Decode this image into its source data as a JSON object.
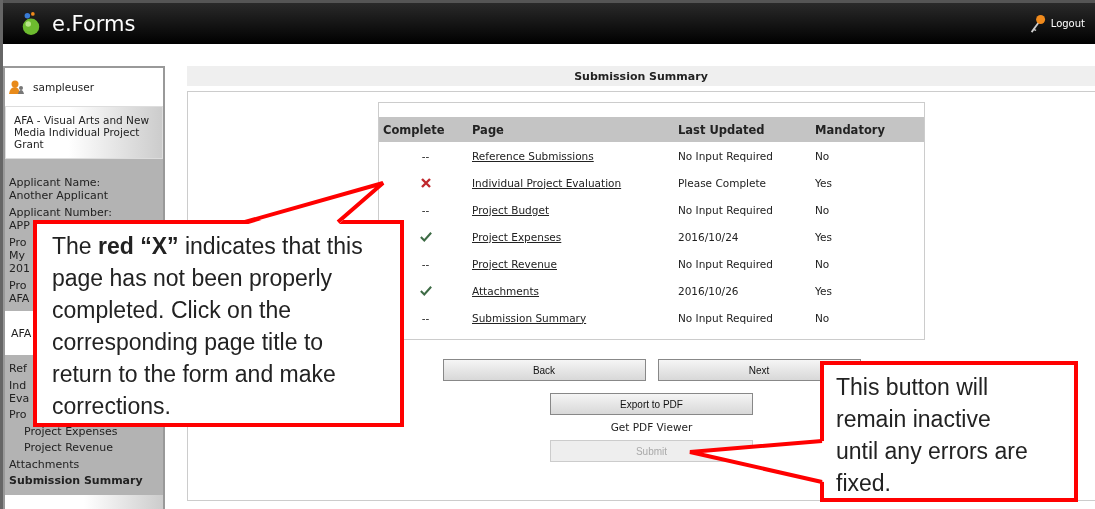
{
  "header": {
    "title": "e.Forms",
    "logout": "Logout"
  },
  "sidebar": {
    "user": "sampleuser",
    "form_title": "AFA - Visual Arts and New Media Individual Project Grant",
    "info": [
      {
        "label": "Applicant Name:",
        "value": [
          "Another Applicant"
        ]
      },
      {
        "label": "Applicant Number:",
        "value": [
          "APP"
        ]
      },
      {
        "label": "Pro",
        "value": [
          "My",
          "201"
        ]
      },
      {
        "label": "Pro",
        "value": [
          "AFA"
        ]
      }
    ],
    "section": "AFA",
    "nav": [
      {
        "lines": [
          "Ref"
        ],
        "selected": false
      },
      {
        "lines": [
          "Ind",
          "Eva"
        ],
        "selected": false
      },
      {
        "lines": [
          "Pro"
        ],
        "selected": false,
        "children": [
          {
            "lines": [
              "Project Expenses"
            ],
            "selected": false
          },
          {
            "lines": [
              "Project Revenue"
            ],
            "selected": false
          }
        ]
      },
      {
        "lines": [
          "Attachments"
        ],
        "selected": false
      },
      {
        "lines": [
          "Submission Summary"
        ],
        "selected": true
      }
    ]
  },
  "main": {
    "title": "Submission Summary",
    "table": {
      "columns": [
        "Complete",
        "Page",
        "Last Updated",
        "Mandatory"
      ],
      "rows": [
        {
          "kind": "dash",
          "mark": "--",
          "page": "Reference Submissions",
          "updated": "No Input Required",
          "mandatory": "No"
        },
        {
          "kind": "cross",
          "page": "Individual Project Evaluation",
          "updated": "Please Complete",
          "mandatory": "Yes"
        },
        {
          "kind": "dash",
          "mark": "--",
          "page": "Project Budget",
          "updated": "No Input Required",
          "mandatory": "No"
        },
        {
          "kind": "check",
          "page": "Project Expenses",
          "updated": "2016/10/24",
          "mandatory": "Yes"
        },
        {
          "kind": "dash",
          "mark": "--",
          "page": "Project Revenue",
          "updated": "No Input Required",
          "mandatory": "No"
        },
        {
          "kind": "check",
          "page": "Attachments",
          "updated": "2016/10/26",
          "mandatory": "Yes"
        },
        {
          "kind": "dash",
          "mark": "--",
          "page": "Submission Summary",
          "updated": "No Input Required",
          "mandatory": "No"
        }
      ]
    },
    "buttons": [
      {
        "label": "Back",
        "disabled": false
      },
      {
        "label": "Next",
        "disabled": false
      }
    ],
    "export": {
      "label": "Export to PDF",
      "disabled": false
    },
    "viewer_link": "Get PDF Viewer",
    "submit": {
      "label": "Submit",
      "disabled": true
    }
  },
  "callouts": [
    {
      "text": "The **red “X”** indicates that this page has not been properly completed. Click on the corresponding page title to return to the form and make corrections."
    },
    {
      "text": "This button will remain inactive until any errors are fixed."
    }
  ]
}
